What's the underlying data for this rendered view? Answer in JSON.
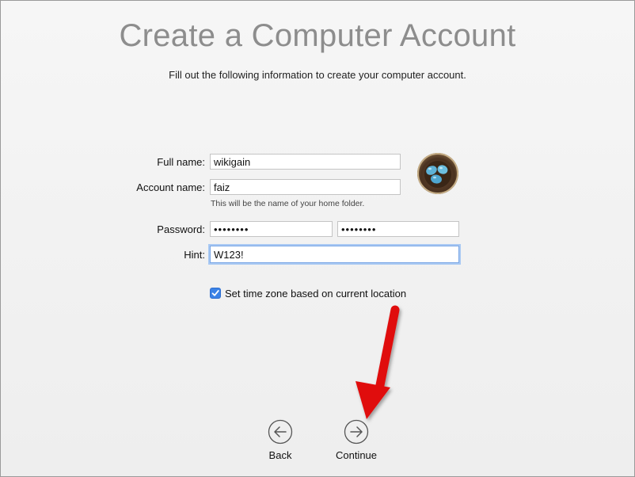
{
  "header": {
    "title": "Create a Computer Account",
    "subtitle": "Fill out the following information to create your computer account."
  },
  "form": {
    "full_name_label": "Full name:",
    "full_name_value": "wikigain",
    "account_name_label": "Account name:",
    "account_name_value": "faiz",
    "account_name_help": "This will be the name of your home folder.",
    "password_label": "Password:",
    "password_value": "••••••••",
    "password_verify_value": "••••••••",
    "hint_label": "Hint:",
    "hint_value": "W123!",
    "timezone_label": "Set time zone based on current location",
    "timezone_checked": true
  },
  "avatar": {
    "icon": "bird-nest-eggs-icon"
  },
  "nav": {
    "back_label": "Back",
    "continue_label": "Continue"
  },
  "colors": {
    "accent": "#3b82e6",
    "title": "#8d8d8d",
    "annotation_arrow": "#e01010"
  }
}
